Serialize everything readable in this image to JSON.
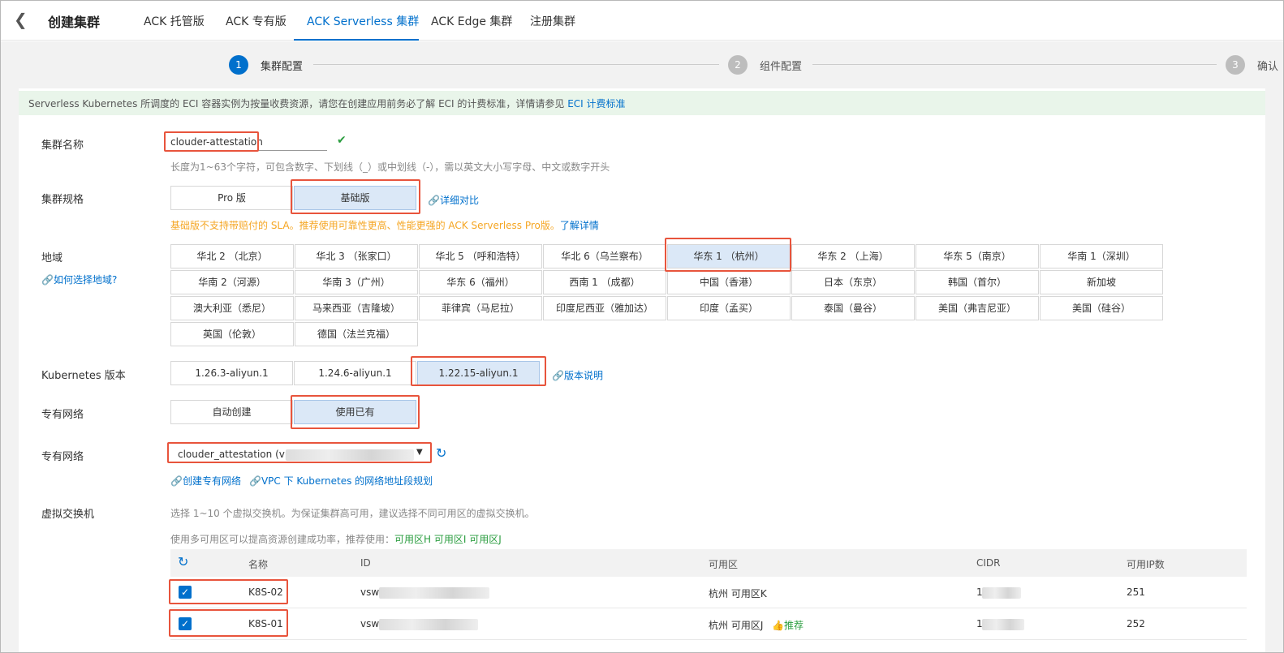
{
  "header": {
    "back_icon": "chevron-left-icon",
    "title": "创建集群",
    "tabs": [
      "ACK 托管版",
      "ACK 专有版",
      "ACK Serverless 集群",
      "ACK Edge 集群",
      "注册集群"
    ]
  },
  "steps": [
    {
      "num": "1",
      "label": "集群配置"
    },
    {
      "num": "2",
      "label": "组件配置"
    },
    {
      "num": "3",
      "label": "确认"
    }
  ],
  "notice": {
    "text": "Serverless Kubernetes 所调度的 ECI 容器实例为按量收费资源，请您在创建应用前务必了解 ECI 的计费标准，详情请参见 ",
    "link": "ECI 计费标准"
  },
  "cluster_name": {
    "label": "集群名称",
    "value": "clouder-attestation",
    "hint": "长度为1~63个字符，可包含数字、下划线（_）或中划线（-），需以英文大小写字母、中文或数字开头"
  },
  "spec": {
    "label": "集群规格",
    "options": [
      "Pro 版",
      "基础版"
    ],
    "compare_link": "详细对比",
    "warning": "基础版不支持带赔付的 SLA。推荐使用可靠性更高、性能更强的 ACK Serverless Pro版。",
    "warning_link": "了解详情"
  },
  "region": {
    "label": "地域",
    "help_link": "如何选择地域?",
    "options": [
      "华北 2 （北京）",
      "华北 3 （张家口）",
      "华北 5 （呼和浩特）",
      "华北 6（乌兰察布）",
      "华东 1 （杭州）",
      "华东 2 （上海）",
      "华东 5（南京）",
      "华南 1（深圳）",
      "华南 2（河源）",
      "华南 3（广州）",
      "华东 6（福州）",
      "西南 1 （成都）",
      "中国（香港）",
      "日本（东京）",
      "韩国（首尔）",
      "新加坡",
      "澳大利亚（悉尼）",
      "马来西亚（吉隆坡）",
      "菲律宾（马尼拉）",
      "印度尼西亚（雅加达）",
      "印度（孟买）",
      "泰国（曼谷）",
      "美国（弗吉尼亚）",
      "美国（硅谷）",
      "英国（伦敦）",
      "德国（法兰克福）"
    ]
  },
  "k8s": {
    "label": "Kubernetes 版本",
    "options": [
      "1.26.3-aliyun.1",
      "1.24.6-aliyun.1",
      "1.22.15-aliyun.1"
    ],
    "notes_link": "版本说明"
  },
  "vpc_mode": {
    "label": "专有网络",
    "options": [
      "自动创建",
      "使用已有"
    ]
  },
  "vpc_select": {
    "label": "专有网络",
    "value": "clouder_attestation (vpc-",
    "create_link": "创建专有网络",
    "plan_link": "VPC 下 Kubernetes 的网络地址段规划"
  },
  "vswitch": {
    "label": "虚拟交换机",
    "hint1": "选择 1~10 个虚拟交换机。为保证集群高可用，建议选择不同可用区的虚拟交换机。",
    "hint2": "使用多可用区可以提高资源创建成功率，推荐使用：",
    "zones": "可用区H 可用区I 可用区J",
    "columns": [
      "名称",
      "ID",
      "可用区",
      "CIDR",
      "可用IP数"
    ],
    "rows": [
      {
        "name": "K8S-02",
        "id": "vsw-",
        "zone": "杭州 可用区K",
        "cidr": "1",
        "ips": "251",
        "rec": ""
      },
      {
        "name": "K8S-01",
        "id": "vsw-",
        "zone": "杭州 可用区J",
        "cidr": "1",
        "ips": "252",
        "rec": "推荐"
      }
    ]
  },
  "colors": {
    "primary": "#0070cc",
    "highlight": "#e8543c",
    "selected": "#dbe8f7",
    "warn": "#f5a623",
    "ok": "#2a9d3f"
  }
}
